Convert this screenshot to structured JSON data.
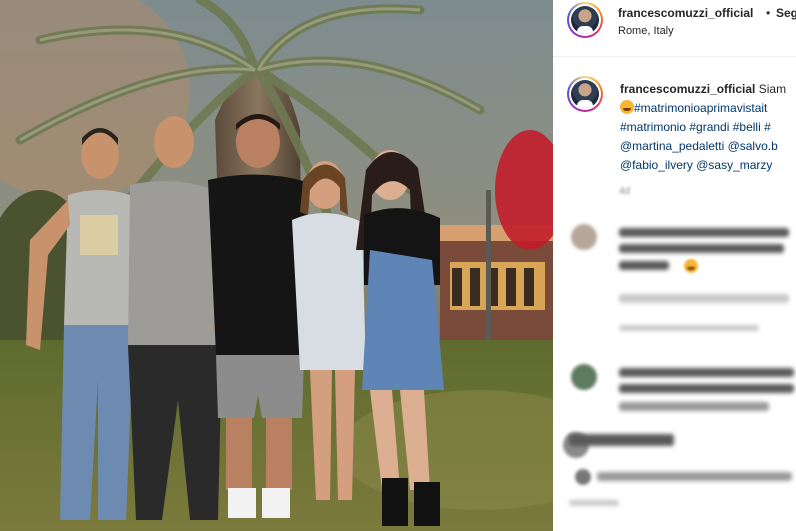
{
  "post": {
    "username": "francescomuzzi_official",
    "separator": "•",
    "follow_label": "Seg",
    "location": "Rome, Italy"
  },
  "caption": {
    "username": "francescomuzzi_official",
    "text": "Siam",
    "line2": "#matrimonioaprimavistait",
    "line3": "#matrimonio #grandi #belli #",
    "line4": "@martina_pedaletti @salvo.b",
    "line5": "@fabio_ilvery @sasy_marzy",
    "time": "4d"
  },
  "comments": [
    {
      "avatar_color": "#b6a69a"
    },
    {
      "avatar_color": "#5c7a5e"
    },
    {
      "avatar_color": "#8a8a8a"
    }
  ],
  "icons": {
    "header_avatar": "profile-avatar",
    "caption_avatar": "profile-avatar",
    "emoji": "grinning-face-emoji"
  }
}
